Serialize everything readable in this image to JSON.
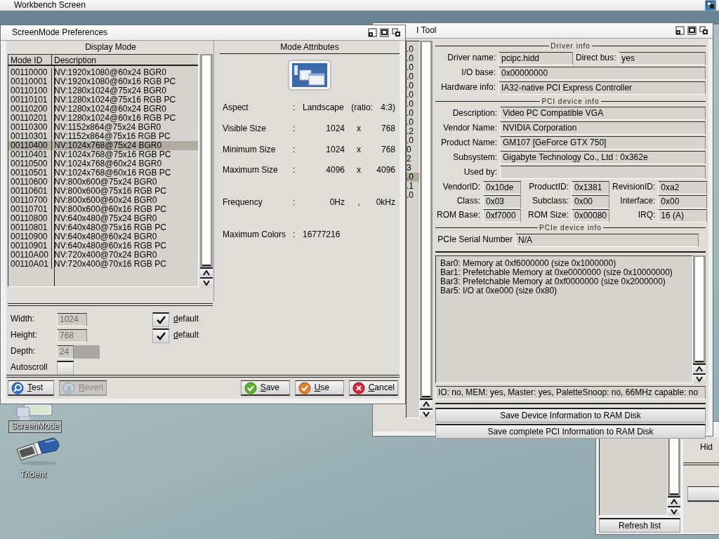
{
  "screen": {
    "title": "Workbench Screen"
  },
  "desktop_icons": [
    {
      "label": "ScreenMode",
      "selected": true
    },
    {
      "label": "Trident",
      "selected": false
    }
  ],
  "screenmode_window": {
    "title": "ScreenMode Preferences",
    "display_mode": {
      "heading": "Display Mode",
      "columns": [
        "Mode ID",
        "Description"
      ],
      "rows": [
        {
          "id": "00110000",
          "description": "NV:1920x1080@60x24 BGR0",
          "selected": false
        },
        {
          "id": "00110001",
          "description": "NV:1920x1080@60x16 RGB PC",
          "selected": false
        },
        {
          "id": "00110100",
          "description": "NV:1280x1024@75x24 BGR0",
          "selected": false
        },
        {
          "id": "00110101",
          "description": "NV:1280x1024@75x16 RGB PC",
          "selected": false
        },
        {
          "id": "00110200",
          "description": "NV:1280x1024@60x24 BGR0",
          "selected": false
        },
        {
          "id": "00110201",
          "description": "NV:1280x1024@60x16 RGB PC",
          "selected": false
        },
        {
          "id": "00110300",
          "description": "NV:1152x864@75x24 BGR0",
          "selected": false
        },
        {
          "id": "00110301",
          "description": "NV:1152x864@75x16 RGB PC",
          "selected": false
        },
        {
          "id": "00110400",
          "description": "NV:1024x768@75x24 BGR0",
          "selected": true
        },
        {
          "id": "00110401",
          "description": "NV:1024x768@75x16 RGB PC",
          "selected": false
        },
        {
          "id": "00110500",
          "description": "NV:1024x768@60x24 BGR0",
          "selected": false
        },
        {
          "id": "00110501",
          "description": "NV:1024x768@60x16 RGB PC",
          "selected": false
        },
        {
          "id": "00110600",
          "description": "NV:800x600@75x24 BGR0",
          "selected": false
        },
        {
          "id": "00110601",
          "description": "NV:800x600@75x16 RGB PC",
          "selected": false
        },
        {
          "id": "00110700",
          "description": "NV:800x600@60x24 BGR0",
          "selected": false
        },
        {
          "id": "00110701",
          "description": "NV:800x600@60x16 RGB PC",
          "selected": false
        },
        {
          "id": "00110800",
          "description": "NV:640x480@75x24 BGR0",
          "selected": false
        },
        {
          "id": "00110801",
          "description": "NV:640x480@75x16 RGB PC",
          "selected": false
        },
        {
          "id": "00110900",
          "description": "NV:640x480@60x24 BGR0",
          "selected": false
        },
        {
          "id": "00110901",
          "description": "NV:640x480@60x16 RGB PC",
          "selected": false
        },
        {
          "id": "00110A00",
          "description": "NV:720x400@70x24 BGR0",
          "selected": false
        },
        {
          "id": "00110A01",
          "description": "NV:720x400@70x16 RGB PC",
          "selected": false
        }
      ]
    },
    "mode_attributes": {
      "heading": "Mode Attributes",
      "rows": [
        {
          "kind": "aspect",
          "label": "Aspect",
          "separator": ":",
          "value": "Landscape",
          "middle": "(ratio:",
          "value_2": "4:3)"
        },
        {
          "kind": "size",
          "label": "Visible Size",
          "separator": ":",
          "value": "1024",
          "middle": "x",
          "value_2": "768"
        },
        {
          "kind": "size",
          "label": "Minimum Size",
          "separator": ":",
          "value": "1024",
          "middle": "x",
          "value_2": "768"
        },
        {
          "kind": "size",
          "label": "Maximum Size",
          "separator": ":",
          "value": "4096",
          "middle": "x",
          "value_2": "4096"
        },
        {
          "kind": "frequency",
          "label": "Frequency",
          "separator": ":",
          "value": "0Hz",
          "middle": ",",
          "value_2": "0kHz"
        },
        {
          "kind": "colors",
          "label": "Maximum Colors",
          "separator": ":",
          "value": "16777216"
        }
      ]
    },
    "fields": [
      {
        "kind": "number",
        "label": "Width:",
        "value": "1024",
        "disabled": true,
        "default_label": "default",
        "default_checked": true
      },
      {
        "kind": "number",
        "label": "Height:",
        "value": "768",
        "disabled": true,
        "default_label": "default",
        "default_checked": true
      },
      {
        "kind": "slider",
        "label": "Depth:",
        "value": "24",
        "disabled": true
      },
      {
        "kind": "checkbox",
        "label": "Autoscroll",
        "checked": false
      }
    ],
    "buttons": [
      {
        "label": "Test",
        "kind": "test",
        "disabled": false
      },
      {
        "label": "Revert",
        "kind": "revert",
        "disabled": true
      },
      {
        "label": "Save",
        "kind": "save",
        "disabled": false
      },
      {
        "label": "Use",
        "kind": "use",
        "disabled": false
      },
      {
        "label": "Cancel",
        "kind": "cancel",
        "disabled": false
      }
    ]
  },
  "pci_tool_window": {
    "title": "I Tool",
    "device_list": [
      {
        "text": ".0",
        "selected": false
      },
      {
        "text": ".0",
        "selected": false
      },
      {
        "text": ".0",
        "selected": false
      },
      {
        "text": ".0",
        "selected": false
      },
      {
        "text": ".0",
        "selected": false
      },
      {
        "text": ".0",
        "selected": false
      },
      {
        "text": ".0",
        "selected": false
      },
      {
        "text": ".0",
        "selected": false
      },
      {
        "text": ".0",
        "selected": false
      },
      {
        "text": ".2",
        "selected": false
      },
      {
        "text": ".0",
        "selected": false
      },
      {
        "text": "0",
        "selected": false
      },
      {
        "text": "2",
        "selected": false
      },
      {
        "text": "3",
        "selected": false
      },
      {
        "text": ".0",
        "selected": true
      },
      {
        "text": ".1",
        "selected": false
      },
      {
        "text": ".0",
        "selected": false
      }
    ],
    "driver_info": {
      "heading": "Driver info",
      "rows": [
        [
          {
            "label": "Driver name:",
            "value": "pcipc.hidd"
          },
          {
            "label": "Direct bus:",
            "value": "yes"
          }
        ],
        [
          {
            "label": "I/O base:",
            "value": "0x00000000"
          }
        ],
        [
          {
            "label": "Hardware info:",
            "value": "IA32-native PCI Express Controller"
          }
        ]
      ]
    },
    "device_info": {
      "heading": "PCI device info",
      "rows": [
        [
          {
            "label": "Description:",
            "value": "Video PC Compatible VGA"
          }
        ],
        [
          {
            "label": "Vendor Name:",
            "value": "NVIDIA Corporation"
          }
        ],
        [
          {
            "label": "Product Name:",
            "value": "GM107 [GeForce GTX 750]"
          }
        ],
        [
          {
            "label": "Subsystem:",
            "value": "Gigabyte Technology Co., Ltd : 0x362e"
          }
        ],
        [
          {
            "label": "Used by:"
          }
        ]
      ],
      "id_grid": [
        [
          {
            "label": "VendorID:",
            "value": "0x10de"
          },
          {
            "label": "ProductID:",
            "value": "0x1381"
          },
          {
            "label": "RevisionID:",
            "value": "0xa2"
          }
        ],
        [
          {
            "label": "Class:",
            "value": "0x03"
          },
          {
            "label": "Subclass:",
            "value": "0x00"
          },
          {
            "label": "Interface:",
            "value": "0x00"
          }
        ],
        [
          {
            "label": "ROM Base:",
            "value": "0xf7000"
          },
          {
            "label": "ROM Size:",
            "value": "0x00080"
          },
          {
            "label": "IRQ:",
            "value": "16 (A)"
          }
        ]
      ]
    },
    "pcie_info": {
      "heading": "PCIe device info",
      "rows": [
        [
          {
            "label": "PCIe Serial Number",
            "value": "N/A"
          }
        ]
      ]
    },
    "resources": [
      "Bar0: Memory at 0xf6000000 (size 0x1000000)",
      "Bar1: Prefetchable Memory at 0xe0000000 (size 0x10000000)",
      "Bar3: Prefetchable Memory at 0xf0000000 (size 0x2000000)",
      "Bar5: I/O at 0xe000 (size 0x80)"
    ],
    "status": "IO: no, MEM: yes, Master: yes, PaletteSnoop: no, 66MHz capable: no",
    "buttons": [
      "Save Device Information to RAM Disk",
      "Save complete PCI Information to RAM Disk"
    ]
  },
  "back_window": {
    "side_text": "Hid",
    "buttons": [
      "Refresh list"
    ]
  }
}
